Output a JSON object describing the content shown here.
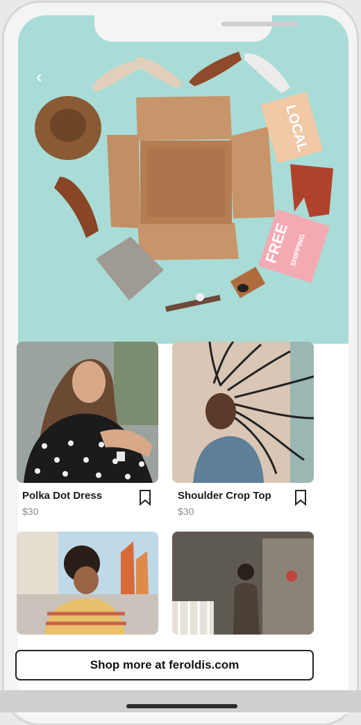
{
  "hero": {
    "back_icon": "chevron-left-icon",
    "badges": {
      "local": "LOCAL",
      "free": "FREE",
      "shipping": "SHIPPING"
    }
  },
  "products": [
    {
      "name": "Polka Dot Dress",
      "price": "$30"
    },
    {
      "name": "Shoulder Crop Top",
      "price": "$30"
    },
    {
      "name": "",
      "price": ""
    },
    {
      "name": "",
      "price": ""
    }
  ],
  "shop_more": {
    "label": "Shop more at feroldis.com"
  },
  "colors": {
    "hero_bg": "#a9dcd6",
    "local_badge": "#f1c9a6",
    "free_badge": "#f4aab3"
  }
}
